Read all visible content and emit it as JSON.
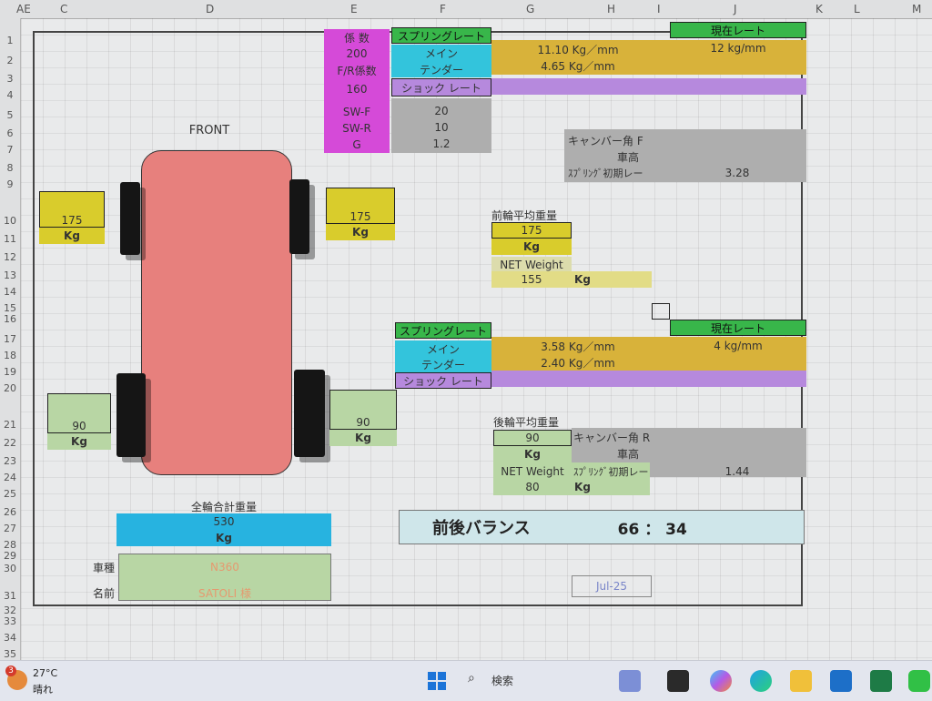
{
  "columns": [
    "AE",
    "C",
    "D",
    "E",
    "F",
    "G",
    "H",
    "I",
    "J",
    "K",
    "L",
    "M"
  ],
  "rows": [
    "1",
    "2",
    "3",
    "4",
    "5",
    "6",
    "7",
    "8",
    "9",
    "10",
    "11",
    "12",
    "13",
    "14",
    "15",
    "16",
    "17",
    "18",
    "19",
    "20",
    "21",
    "22",
    "23",
    "24",
    "25",
    "26",
    "27",
    "28",
    "29",
    "30",
    "31",
    "32",
    "33",
    "34",
    "35"
  ],
  "coeff": {
    "header": "係 数",
    "v1": "200",
    "fr_label": "F/R係数",
    "v2": "160",
    "swf": "SW-F",
    "swr": "SW-R",
    "g": "G",
    "swf_val": "20",
    "swr_val": "10",
    "g_val": "1.2"
  },
  "front": {
    "label": "FRONT",
    "spring_rate_label": "スプリングレート",
    "main_label": "メイン",
    "main_value": "11.10 Kg／mm",
    "tender_label": "テンダー",
    "tender_value": "4.65 Kg／mm",
    "shock_label": "ショック レート",
    "current_rate_label": "現在レート",
    "current_rate_value": "12 kg/mm",
    "camber_label": "キャンバー角 F",
    "height_label": "車高",
    "initial_label": "ｽﾌﾟﾘﾝｸﾞ初期レー",
    "initial_value": "3.28",
    "avg_label": "前輪平均重量",
    "avg_value": "175",
    "avg_unit": "Kg",
    "net_label": "NET Weight",
    "net_value": "155",
    "net_unit": "Kg",
    "left_wheel": "175",
    "right_wheel": "175",
    "wheel_unit": "Kg"
  },
  "rear": {
    "spring_rate_label": "スプリングレート",
    "main_label": "メイン",
    "main_value": "3.58 Kg／mm",
    "tender_label": "テンダー",
    "tender_value": "2.40 Kg／mm",
    "shock_label": "ショック レート",
    "current_rate_label": "現在レート",
    "current_rate_value": "4 kg/mm",
    "avg_label": "後輪平均重量",
    "avg_value": "90",
    "avg_unit": "Kg",
    "camber_label": "キャンバー角 R",
    "height_label": "車高",
    "net_label": "NET Weight",
    "net_value": "80",
    "net_unit": "Kg",
    "initial_label": "ｽﾌﾟﾘﾝｸﾞ初期レー",
    "initial_value": "1.44",
    "left_wheel": "90",
    "right_wheel": "90",
    "wheel_unit": "Kg"
  },
  "total": {
    "label": "全輪合計重量",
    "value": "530",
    "unit": "Kg"
  },
  "balance": {
    "label": "前後バランス",
    "value": "66 ： 34"
  },
  "vehicle": {
    "model_label": "車種",
    "model_value": "N360",
    "name_label": "名前",
    "name_value": "SATOLI 様"
  },
  "date": "Jul-25",
  "taskbar": {
    "weather_temp": "27°C",
    "weather_desc": "晴れ",
    "badge": "3",
    "search": "検索"
  }
}
